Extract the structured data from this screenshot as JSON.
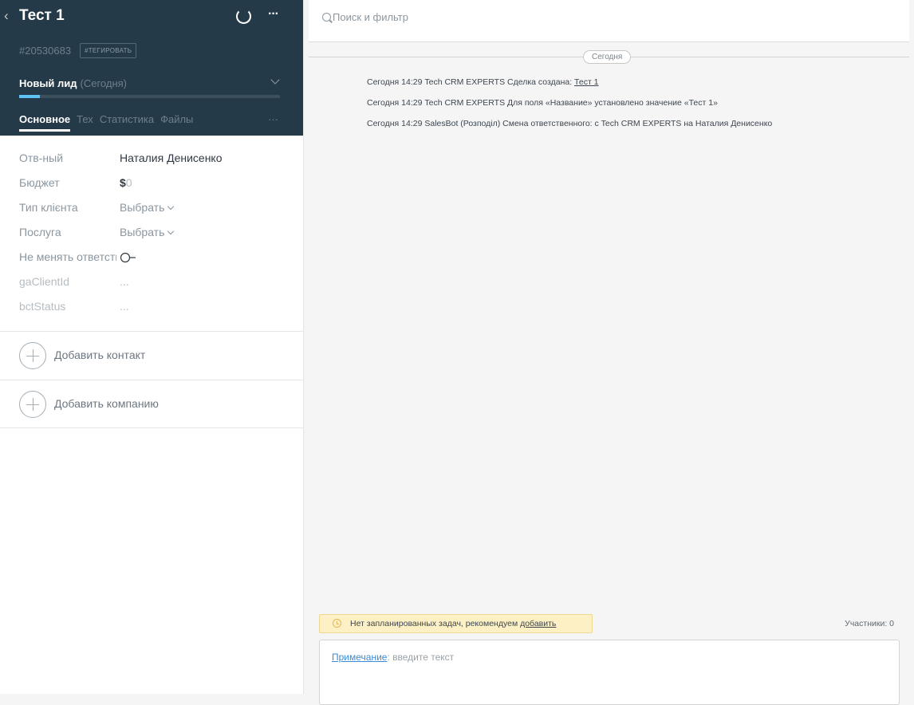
{
  "header": {
    "title": "Тест 1",
    "deal_id": "#20530683",
    "tag_label": "#ТЕГИРОВАТЬ",
    "stage": {
      "name": "Новый лид",
      "date": "(Сегодня)",
      "progress": 0.08
    },
    "tabs": [
      {
        "label": "Основное",
        "active": true
      },
      {
        "label": "Тех",
        "active": false
      },
      {
        "label": "Статистика",
        "active": false
      },
      {
        "label": "Файлы",
        "active": false
      }
    ],
    "tabs_more": "···",
    "more_icon": "···"
  },
  "fields": {
    "responsible": {
      "label": "Отв-ный",
      "value": "Наталия Денисенко"
    },
    "budget": {
      "label": "Бюджет",
      "currency": "$",
      "value": "0"
    },
    "client_type": {
      "label": "Тип клієнта",
      "value": "Выбрать"
    },
    "service": {
      "label": "Послуга",
      "value": "Выбрать"
    },
    "no_change": {
      "label": "Не менять ответственного"
    },
    "ga_client_id": {
      "label": "gaClientId",
      "value": "..."
    },
    "bct_status": {
      "label": "bctStatus",
      "value": "..."
    }
  },
  "actions": {
    "add_contact": "Добавить контакт",
    "add_company": "Добавить компанию"
  },
  "search": {
    "placeholder": "Поиск и фильтр"
  },
  "feed": {
    "day_label": "Сегодня",
    "items": [
      {
        "text": "Сегодня 14:29 Tech CRM EXPERTS Сделка создана: ",
        "link": "Тест 1"
      },
      {
        "text": "Сегодня 14:29 Tech CRM EXPERTS Для поля «Название» установлено значение «Тест 1»"
      },
      {
        "text": "Сегодня 14:29 SalesBot (Розподіл) Смена ответственного: с Tech CRM EXPERTS на Наталия Денисенко"
      }
    ]
  },
  "tasks_notice": {
    "text": "Нет запланированных задач, рекомендуем ",
    "link": "добавить"
  },
  "participants": "Участники: 0",
  "note": {
    "type_label": "Примечание",
    "placeholder": ": введите текст"
  },
  "colors": {
    "header_bg": "#253a48",
    "accent": "#5ec3f2",
    "link": "#3a8bd8",
    "notice_bg": "#fcf0c4"
  },
  "icons": [
    "back-icon",
    "spinner-icon",
    "more-icon",
    "chevron-down-icon",
    "toggle-icon",
    "plus-icon",
    "search-icon",
    "clock-icon"
  ]
}
